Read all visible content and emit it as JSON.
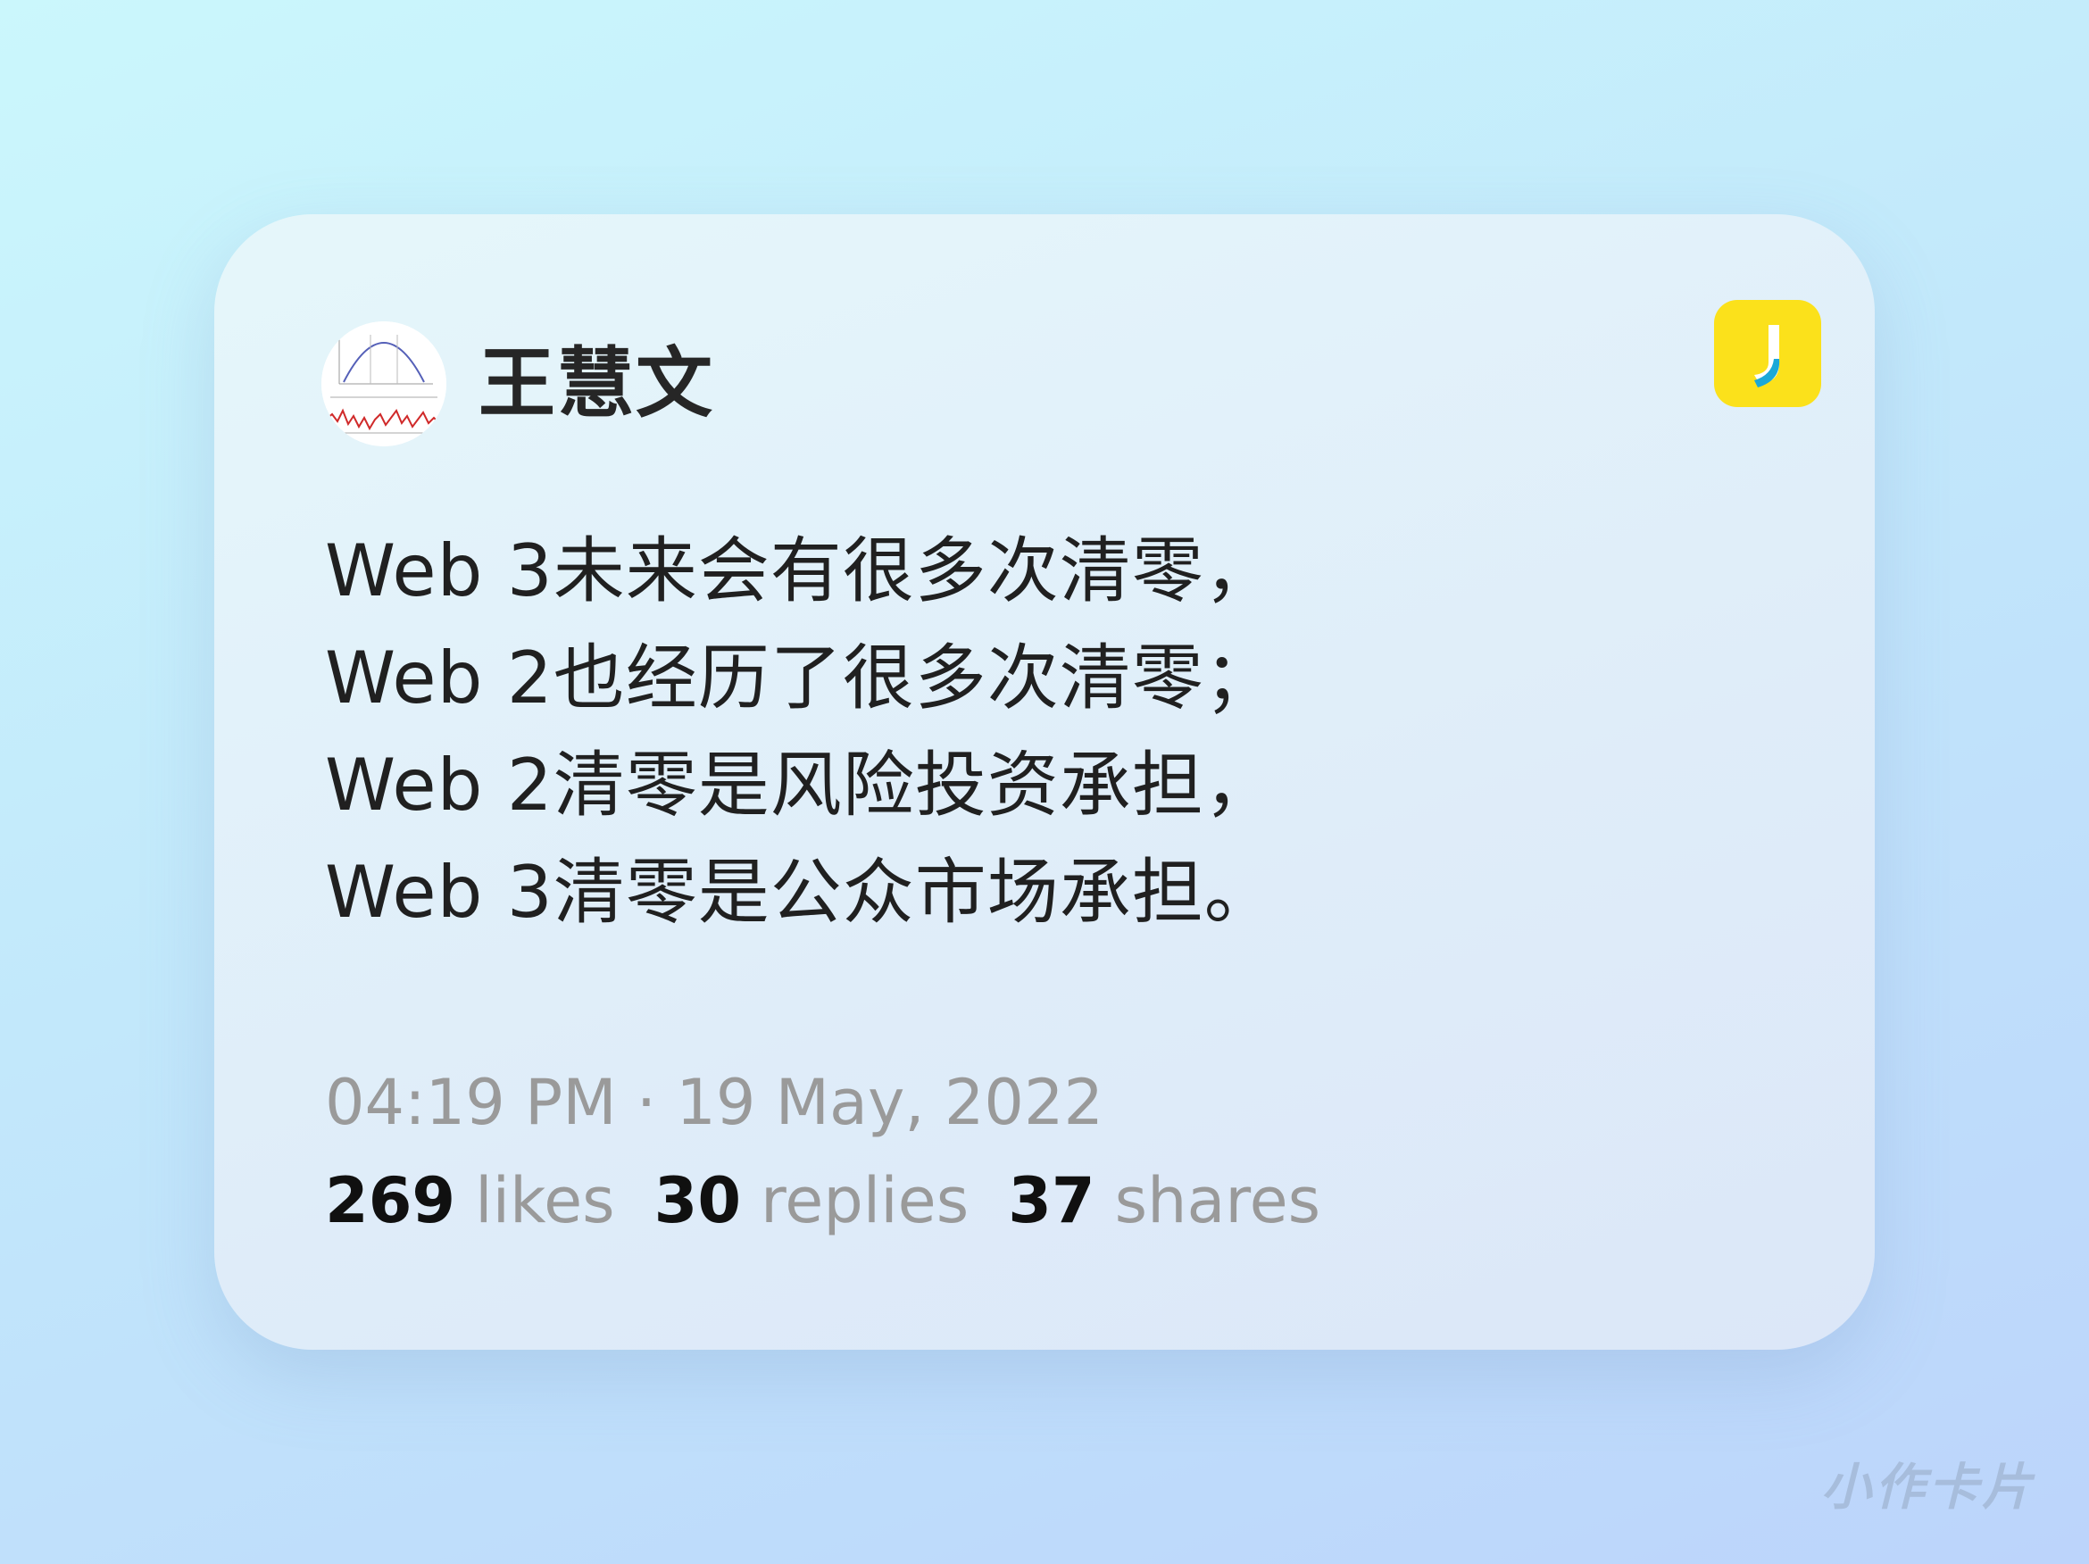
{
  "post": {
    "author": "王慧文",
    "avatar_icon": "chart-avatar-icon",
    "app_icon": "jike-app-icon",
    "content_lines": [
      "Web 3未来会有很多次清零，",
      "Web 2也经历了很多次清零；",
      "Web 2清零是风险投资承担，",
      "Web 3清零是公众市场承担。"
    ],
    "timestamp": "04:19 PM · 19 May, 2022",
    "stats": {
      "likes_count": "269",
      "likes_label": "likes",
      "replies_count": "30",
      "replies_label": "replies",
      "shares_count": "37",
      "shares_label": "shares"
    }
  },
  "watermark": "小作卡片",
  "colors": {
    "badge": "#fbe11b",
    "text": "#202020",
    "muted": "#9a9a9a"
  }
}
